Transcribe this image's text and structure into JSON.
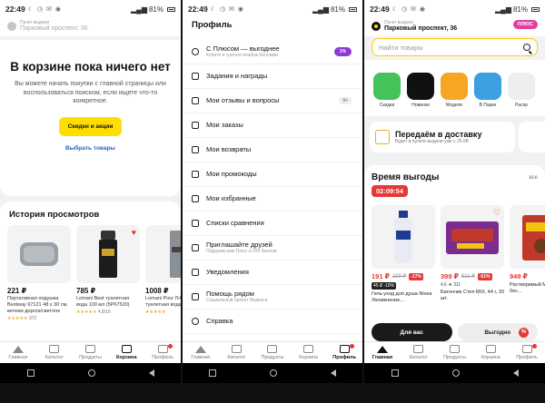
{
  "status": {
    "time": "22:49",
    "battery": "81%"
  },
  "cart_screen": {
    "address_small": "Пункт выдачи",
    "address": "Парковый проспект, 36",
    "empty_title": "В корзине пока ничего нет",
    "empty_text": "Вы можете начать покупки с главной страницы или воспользоваться поиском, если ищете что-то конкретное.",
    "cta_button": "Скидки и акции",
    "link": "Выбрать товары",
    "history_title": "История просмотров",
    "history": [
      {
        "price": "221 ₽",
        "name": "Портативная подушка Bestway 67121 48 x 30 см, вечная дорога/светлое",
        "rating": "★★★★★",
        "reviews": "372"
      },
      {
        "price": "785 ₽",
        "name": "Lomani Best туалетная вода 100 мл (5Р67520)",
        "rating": "★★★★★",
        "reviews": "4,8/16"
      },
      {
        "price": "1008 ₽",
        "name": "Lomani Pour l'Homme туалетная вода",
        "rating": "★★★★★",
        "reviews": ""
      }
    ]
  },
  "profile_screen": {
    "title": "Профиль",
    "items": [
      {
        "label": "С Плюсом — выгоднее",
        "sub": "Копите и тратьте кешбэк баллами",
        "badge": "1%"
      },
      {
        "label": "Задания и награды",
        "sub": "",
        "badge": ""
      },
      {
        "label": "Мои отзывы и вопросы",
        "sub": "",
        "badge": "9+"
      },
      {
        "label": "Мои заказы",
        "sub": "",
        "badge": ""
      },
      {
        "label": "Мои возвраты",
        "sub": "",
        "badge": ""
      },
      {
        "label": "Мои промокоды",
        "sub": "",
        "badge": ""
      },
      {
        "label": "Мои избранные",
        "sub": "",
        "badge": ""
      },
      {
        "label": "Списки сравнения",
        "sub": "",
        "badge": ""
      },
      {
        "label": "Приглашайте друзей",
        "sub": "Подарим вам Плюс и 200 баллов",
        "badge": ""
      },
      {
        "label": "Уведомления",
        "sub": "",
        "badge": ""
      },
      {
        "label": "Помощь рядом",
        "sub": "Социальный проект Яндекса",
        "badge": ""
      },
      {
        "label": "Справка",
        "sub": "",
        "badge": ""
      }
    ]
  },
  "home_screen": {
    "address_small": "Пункт выдачи",
    "address": "Парковый проспект, 36",
    "plus_badge": "ПЛЮС",
    "search_placeholder": "Найти товары",
    "categories": [
      {
        "label": "Скидки",
        "color": "#43c35a"
      },
      {
        "label": "Новинки",
        "color": "#111111"
      },
      {
        "label": "Модели",
        "color": "#f5a623"
      },
      {
        "label": "В Парке",
        "color": "#3aa0e0"
      },
      {
        "label": "Распр",
        "color": "#eeeeee"
      }
    ],
    "delivery_title": "Передаём в доставку",
    "delivery_sub": "Будет в пункте выдачи уже с 25.08",
    "deals_title": "Время выгоды",
    "deals_all": "все",
    "timer": "02:09:54",
    "deals": [
      {
        "price": "191 ₽",
        "old": "229 ₽",
        "pct": "-17%",
        "meta": "45 ₽ -18%",
        "name": "Гель-уход для душа Nivea Увлажнение..."
      },
      {
        "price": "399 ₽",
        "old": "811 ₽",
        "pct": "-51%",
        "meta": "4,6 ★ 311",
        "name": "Батончик Степ MIX, 44 г, 20 шт."
      },
      {
        "price": "949 ₽",
        "old": "",
        "pct": "",
        "meta": "",
        "name": "Растворимый MacCoffee бес..."
      }
    ],
    "toggle_on": "Для вас",
    "toggle_off": "Выгодно",
    "toggle_pct": "%"
  },
  "tabs": [
    "Главная",
    "Каталог",
    "Продукты",
    "Корзина",
    "Профиль"
  ]
}
